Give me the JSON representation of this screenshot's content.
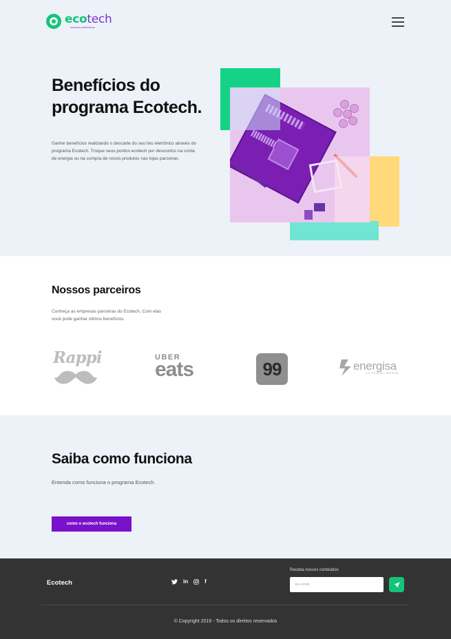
{
  "header": {
    "logo_prefix": "eco",
    "logo_suffix": "tech",
    "logo_tagline": "resíduos eletrônicos",
    "menu_icon": "hamburger-menu-icon"
  },
  "hero": {
    "title": "Benefícios do programa Ecotech.",
    "text": "Ganhe benefícios realizando o descarte do seu lixo eletrônico através do programa Ecotech. Troque seus pontos ecotech por descontos na conta de energia ou na compra de novos produtos nas lojas parceiras."
  },
  "partners": {
    "title": "Nossos parceiros",
    "text": "Conheça as empresas parceiras do Ecotech. Com elas você pode ganhar ótimos benefícios.",
    "rappi": "Rappi",
    "uber_top": "UBER",
    "uber_bottom": "eats",
    "ninety_nine": "99",
    "energisa": "energisa",
    "energisa_sub": "LUZ. INOVAÇÃO. REALIDADE"
  },
  "how": {
    "title": "Saiba como funciona",
    "text": "Entenda como funciona o programa Ecotech.",
    "button": "como o ecotech funciona"
  },
  "footer": {
    "brand": "Ecotech",
    "socials": [
      "twitter-icon",
      "linkedin-icon",
      "instagram-icon",
      "facebook-icon"
    ],
    "linkedin_label": "in",
    "facebook_label": "f",
    "newsletter_label": "Receba nossos conteúdos",
    "newsletter_placeholder": "seu email",
    "copyright": "© Copyright 2019 - Todos os direitos reservados"
  },
  "colors": {
    "green": "#14c47a",
    "purple": "#7a12c9",
    "footer_bg": "#333333",
    "page_bg": "#edf2f8"
  }
}
